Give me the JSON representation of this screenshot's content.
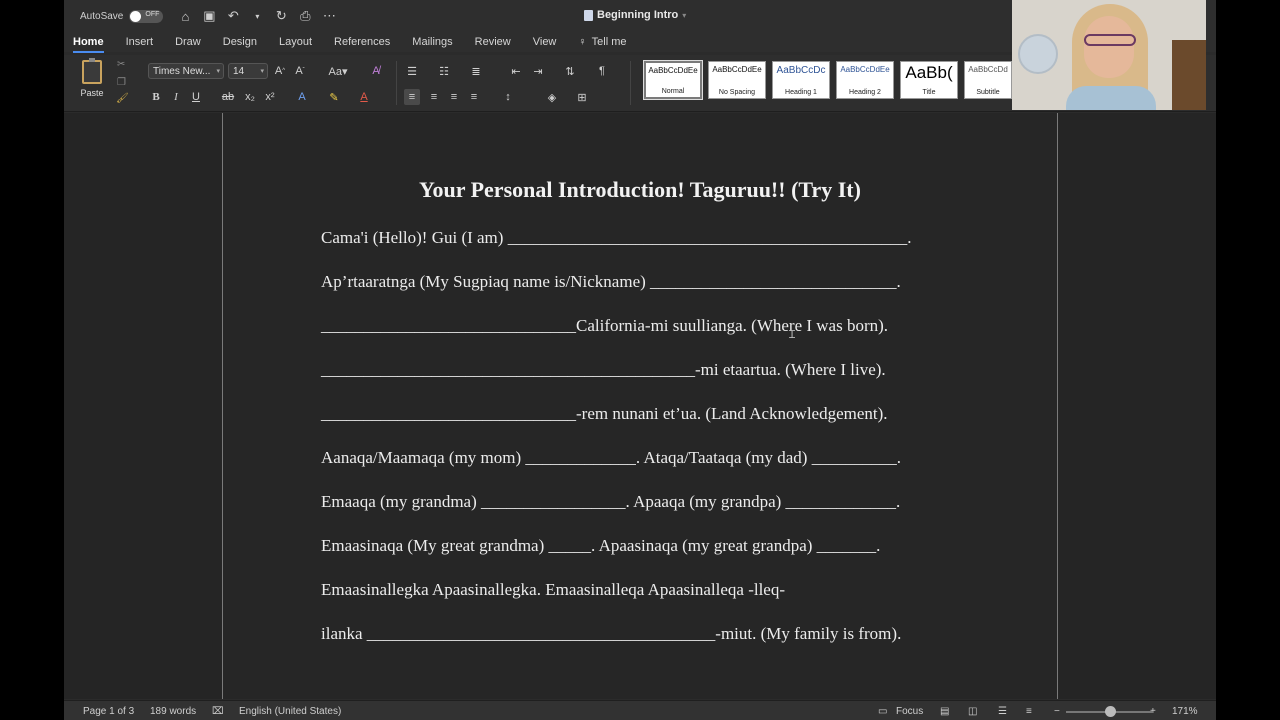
{
  "titlebar": {
    "autosave_label": "AutoSave",
    "autosave_state": "OFF",
    "doc_title": "Beginning Intro"
  },
  "tabs": [
    "Home",
    "Insert",
    "Draw",
    "Design",
    "Layout",
    "References",
    "Mailings",
    "Review",
    "View"
  ],
  "tell_me": "Tell me",
  "ribbon": {
    "paste_label": "Paste",
    "font_name": "Times New...",
    "font_size": "14",
    "styles": [
      {
        "preview": "AaBbCcDdEe",
        "name": "Normal"
      },
      {
        "preview": "AaBbCcDdEe",
        "name": "No Spacing"
      },
      {
        "preview": "AaBbCcDc",
        "name": "Heading 1"
      },
      {
        "preview": "AaBbCcDdEe",
        "name": "Heading 2"
      },
      {
        "preview": "AaBb(",
        "name": "Title"
      },
      {
        "preview": "AaBbCcDd",
        "name": "Subtitle"
      }
    ]
  },
  "document": {
    "heading": "Your Personal Introduction! Taguruu!! (Try It)",
    "lines": [
      "Cama'i (Hello)! Gui (I am) _______________________________________________.",
      "Ap’rtaaratnga (My Sugpiaq name is/Nickname) _____________________________.",
      "______________________________California-mi suullianga. (Where I was born).",
      "____________________________________________-mi etaartua. (Where I live).",
      "______________________________-rem nunani et’ua. (Land Acknowledgement).",
      "Aanaqa/Maamaqa (my mom) _____________. Ataqa/Taataqa (my dad) __________.",
      "Emaaqa (my grandma) _________________. Apaaqa (my grandpa) _____________.",
      "Emaasinaqa (My great grandma) _____. Apaasinaqa (my great grandpa) _______.",
      "Emaasinallegka Apaasinallegka. Emaasinalleqa Apaasinalleqa -lleq-",
      "ilanka _________________________________________-miut. (My family is from)."
    ]
  },
  "statusbar": {
    "page": "Page 1 of 3",
    "words": "189 words",
    "language": "English (United States)",
    "focus": "Focus",
    "zoom": "171%"
  }
}
